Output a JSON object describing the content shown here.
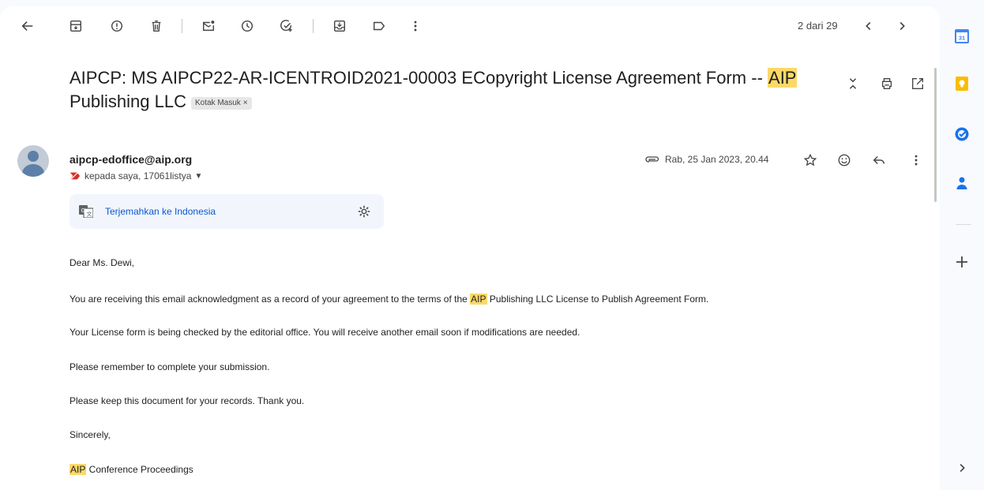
{
  "toolbar": {
    "back": "arrow-left-icon",
    "actions": [
      "archive-icon",
      "report-spam-icon",
      "delete-icon",
      "mark-unread-icon",
      "snooze-icon",
      "add-task-icon",
      "move-to-icon",
      "labels-icon",
      "more-vertical-icon"
    ],
    "pager": "2 dari 29"
  },
  "email": {
    "subject_part1": "AIPCP: MS AIPCP22-AR-ICENTROID2021-00003 ECopyright License Agreement Form -- ",
    "subject_highlight": "AIP",
    "subject_part2": " Publishing LLC",
    "label": "Kotak Masuk",
    "label_close": "×",
    "sender": "aipcp-edoffice@aip.org",
    "recipients": "kepada saya, 17061listya",
    "recipients_caret": "▼",
    "date": "Rab, 25 Jan 2023, 20.44",
    "translate_link": "Terjemahkan ke Indonesia"
  },
  "body": {
    "greeting": "Dear Ms. Dewi,",
    "p1_pre": "You are receiving this email acknowledgment as a record of your agreement to the terms of the ",
    "p1_hl": "AIP",
    "p1_post": " Publishing LLC License to Publish Agreement Form.",
    "p2": "Your License form is being checked by the editorial office. You will receive another email soon if modifications are needed.",
    "p3": "Please remember to complete your submission.",
    "p4": "Please keep this document for your records. Thank you.",
    "p5": "Sincerely,",
    "sig_hl": "AIP",
    "sig_post": " Conference Proceedings"
  },
  "side_panel": {
    "calendar_day": "31",
    "icons": [
      "calendar-icon",
      "keep-icon",
      "tasks-icon",
      "contacts-icon",
      "add-icon",
      "expand-panel-icon"
    ]
  },
  "colors": {
    "highlight": "#fcd868",
    "link": "#0b57d0",
    "important_marker": "#d93025"
  }
}
